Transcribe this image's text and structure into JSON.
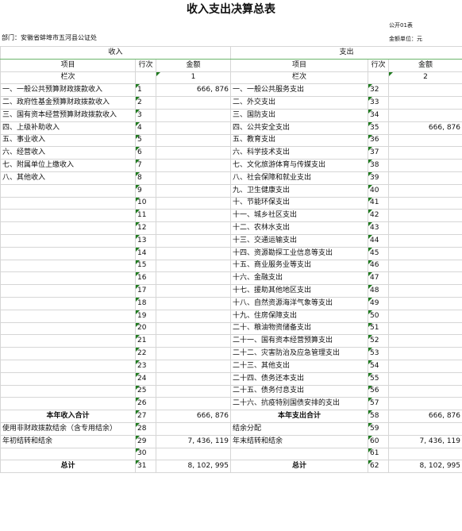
{
  "title": "收入支出决算总表",
  "form_code": "公开01表",
  "department": "部门：安徽省蚌埠市五河县公证处",
  "unit": "金额单位：元",
  "section_income": "收入",
  "section_expense": "支出",
  "headers": {
    "item": "项目",
    "line": "行次",
    "amount": "金额"
  },
  "col_row": {
    "label": "栏次",
    "income_col": "1",
    "expense_col": "2"
  },
  "rows": [
    {
      "li": "一、一般公共预算财政拨款收入",
      "ln": "1",
      "la": "666, 876",
      "ri": "一、一般公共服务支出",
      "rn": "32",
      "ra": ""
    },
    {
      "li": "二、政府性基金预算财政拨款收入",
      "ln": "2",
      "la": "",
      "ri": "二、外交支出",
      "rn": "33",
      "ra": ""
    },
    {
      "li": "三、国有资本经营预算财政拨款收入",
      "ln": "3",
      "la": "",
      "ri": "三、国防支出",
      "rn": "34",
      "ra": ""
    },
    {
      "li": "四、上级补助收入",
      "ln": "4",
      "la": "",
      "ri": "四、公共安全支出",
      "rn": "35",
      "ra": "666, 876"
    },
    {
      "li": "五、事业收入",
      "ln": "5",
      "la": "",
      "ri": "五、教育支出",
      "rn": "36",
      "ra": ""
    },
    {
      "li": "六、经营收入",
      "ln": "6",
      "la": "",
      "ri": "六、科学技术支出",
      "rn": "37",
      "ra": ""
    },
    {
      "li": "七、附属单位上缴收入",
      "ln": "7",
      "la": "",
      "ri": "七、文化旅游体育与传媒支出",
      "rn": "38",
      "ra": ""
    },
    {
      "li": "八、其他收入",
      "ln": "8",
      "la": "",
      "ri": "八、社会保障和就业支出",
      "rn": "39",
      "ra": ""
    },
    {
      "li": "",
      "ln": "9",
      "la": "",
      "ri": "九、卫生健康支出",
      "rn": "40",
      "ra": ""
    },
    {
      "li": "",
      "ln": "10",
      "la": "",
      "ri": "十、节能环保支出",
      "rn": "41",
      "ra": ""
    },
    {
      "li": "",
      "ln": "11",
      "la": "",
      "ri": "十一、城乡社区支出",
      "rn": "42",
      "ra": ""
    },
    {
      "li": "",
      "ln": "12",
      "la": "",
      "ri": "十二、农林水支出",
      "rn": "43",
      "ra": ""
    },
    {
      "li": "",
      "ln": "13",
      "la": "",
      "ri": "十三、交通运输支出",
      "rn": "44",
      "ra": ""
    },
    {
      "li": "",
      "ln": "14",
      "la": "",
      "ri": "十四、资源勘探工业信息等支出",
      "rn": "45",
      "ra": ""
    },
    {
      "li": "",
      "ln": "15",
      "la": "",
      "ri": "十五、商业服务业等支出",
      "rn": "46",
      "ra": ""
    },
    {
      "li": "",
      "ln": "16",
      "la": "",
      "ri": "十六、金融支出",
      "rn": "47",
      "ra": ""
    },
    {
      "li": "",
      "ln": "17",
      "la": "",
      "ri": "十七、援助其他地区支出",
      "rn": "48",
      "ra": ""
    },
    {
      "li": "",
      "ln": "18",
      "la": "",
      "ri": "十八、自然资源海洋气象等支出",
      "rn": "49",
      "ra": ""
    },
    {
      "li": "",
      "ln": "19",
      "la": "",
      "ri": "十九、住房保障支出",
      "rn": "50",
      "ra": ""
    },
    {
      "li": "",
      "ln": "20",
      "la": "",
      "ri": "二十、粮油物资储备支出",
      "rn": "51",
      "ra": ""
    },
    {
      "li": "",
      "ln": "21",
      "la": "",
      "ri": "二十一、国有资本经营预算支出",
      "rn": "52",
      "ra": ""
    },
    {
      "li": "",
      "ln": "22",
      "la": "",
      "ri": "二十二、灾害防治及应急管理支出",
      "rn": "53",
      "ra": ""
    },
    {
      "li": "",
      "ln": "23",
      "la": "",
      "ri": "二十三、其他支出",
      "rn": "54",
      "ra": ""
    },
    {
      "li": "",
      "ln": "24",
      "la": "",
      "ri": "二十四、债务还本支出",
      "rn": "55",
      "ra": ""
    },
    {
      "li": "",
      "ln": "25",
      "la": "",
      "ri": "二十五、债务付息支出",
      "rn": "56",
      "ra": ""
    },
    {
      "li": "",
      "ln": "26",
      "la": "",
      "ri": "二十六、抗疫特别国债安排的支出",
      "rn": "57",
      "ra": ""
    },
    {
      "li": "本年收入合计",
      "ln": "27",
      "la": "666, 876",
      "ri": "本年支出合计",
      "rn": "58",
      "ra": "666, 876",
      "bold": true
    },
    {
      "li": "使用非财政拨款结余（含专用结余）",
      "ln": "28",
      "la": "",
      "ri": "结余分配",
      "rn": "59",
      "ra": ""
    },
    {
      "li": "年初结转和结余",
      "ln": "29",
      "la": "7, 436, 119",
      "ri": "年末结转和结余",
      "rn": "60",
      "ra": "7, 436, 119"
    },
    {
      "li": "",
      "ln": "30",
      "la": "",
      "ri": "",
      "rn": "61",
      "ra": ""
    },
    {
      "li": "总计",
      "ln": "31",
      "la": "8, 102, 995",
      "ri": "总计",
      "rn": "62",
      "ra": "8, 102, 995",
      "bold": true
    }
  ]
}
